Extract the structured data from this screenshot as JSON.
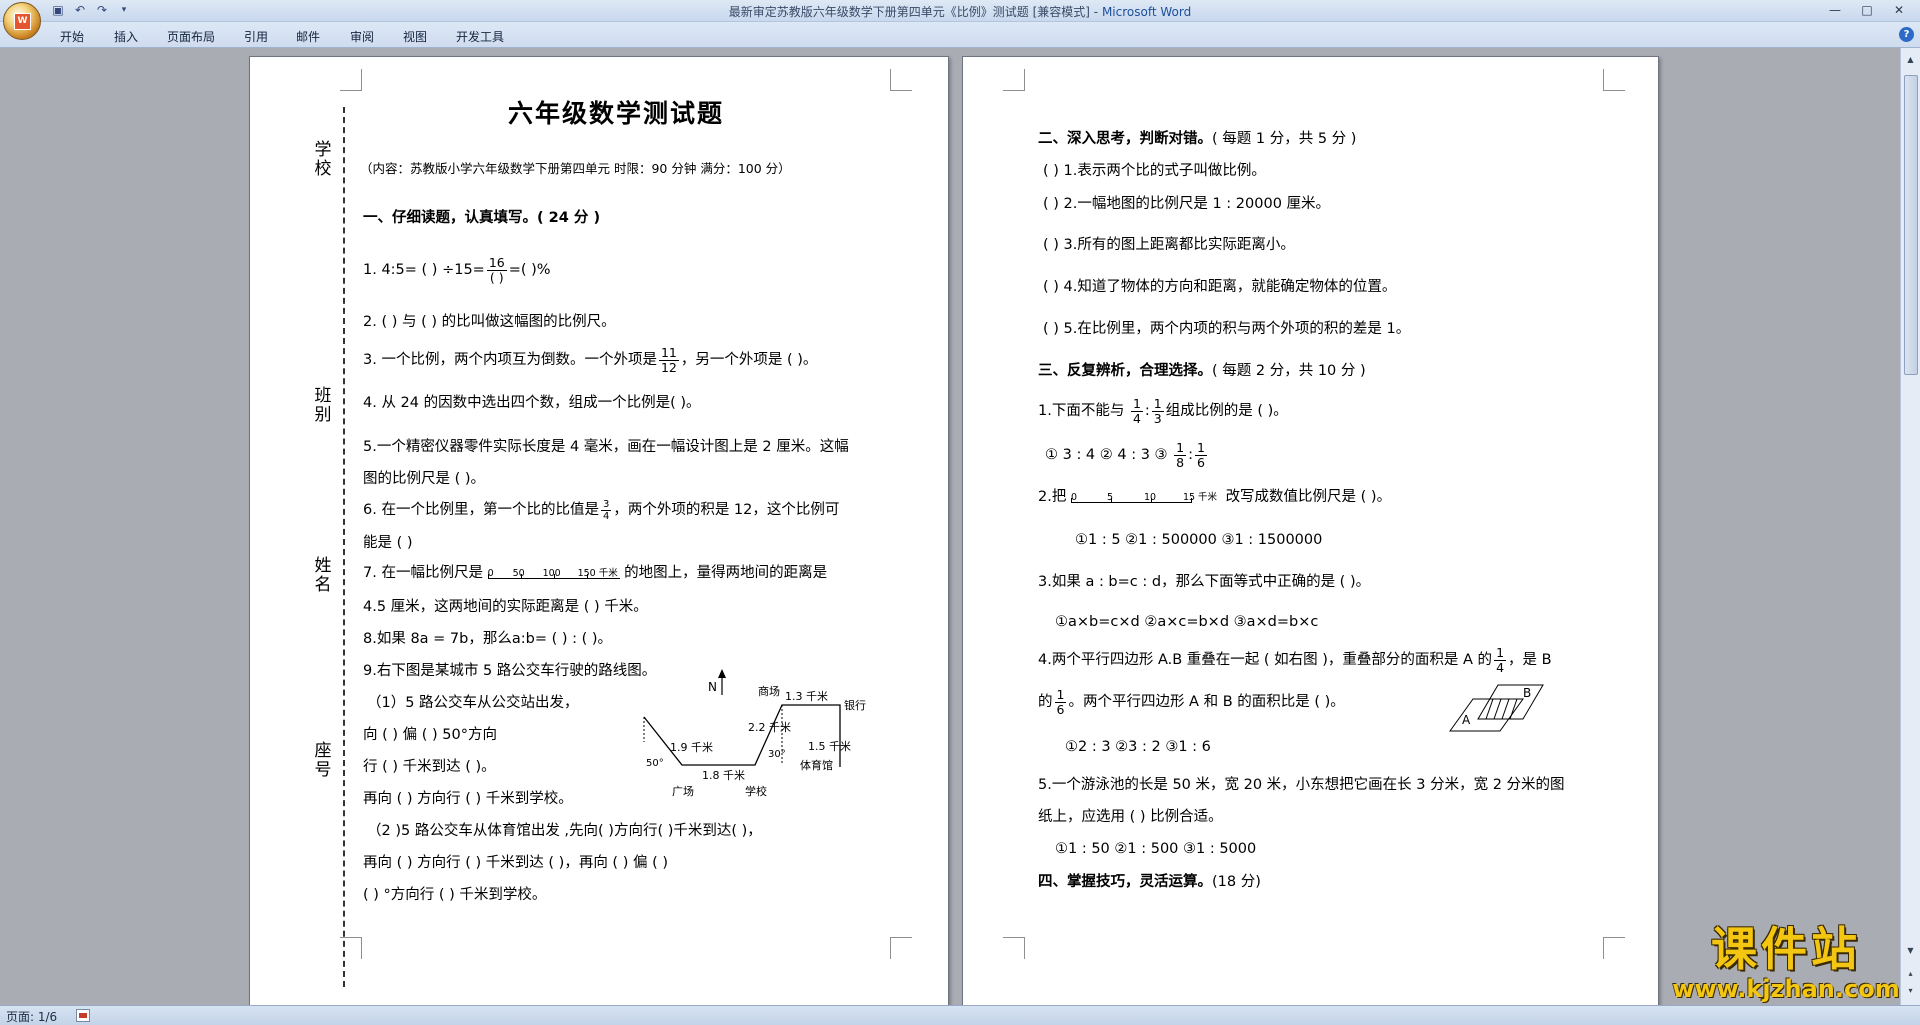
{
  "window": {
    "title": "最新审定苏教版六年级数学下册第四单元《比例》测试题 [兼容模式] -",
    "app": "Microsoft Word"
  },
  "quick_access": [
    "save-icon",
    "undo-icon",
    "redo-icon",
    "customize-icon"
  ],
  "ribbon_tabs": [
    "开始",
    "插入",
    "页面布局",
    "引用",
    "邮件",
    "审阅",
    "视图",
    "开发工具"
  ],
  "status": {
    "page": "页面: 1/6"
  },
  "watermark": {
    "text": "课件站",
    "url": "www.kjzhan.com"
  },
  "side_labels": [
    "学校",
    "班别",
    "姓名",
    "座号"
  ],
  "page1": {
    "title": "六年级数学测试题",
    "subtitle": "（内容：苏教版小学六年级数学下册第四单元    时限：90 分钟    满分：100 分）",
    "s1": "一、仔细读题，认真填写。( 24 分 )",
    "q1a": "1.   4:5= (         ) ÷15=",
    "q1n": "16",
    "q1d": "(       )",
    "q1b": "=(         )%",
    "q2": "2. (                                ) 与 (                              ) 的比叫做这幅图的比例尺。",
    "q3a": "3.  一个比例，两个内项互为倒数。一个外项是",
    "q3n": "11",
    "q3d": "12",
    "q3b": "，另一个外项是 (          )。",
    "q4": "4.  从 24 的因数中选出四个数，组成一个比例是(                                              )。",
    "q5a": "5.一个精密仪器零件实际长度是 4 毫米，画在一幅设计图上是 2 厘米。这幅",
    "q5b": "图的比例尺是 (            )。",
    "q6a": "6.  在一个比例里，第一个比的比值是",
    "q6n": "3",
    "q6d": "4",
    "q6b": "，两个外项的积是 12，这个比例可",
    "q6c": "能是 (                     )",
    "q7a": "7.  在一幅比例尺是",
    "q7ticks": [
      "0",
      "50",
      "100",
      "150 千米"
    ],
    "q7b": "的地图上，量得两地间的距离是",
    "q7c": "4.5 厘米，这两地间的实际距离是 (              ) 千米。",
    "q8": "8.如果 8a = 7b，那么a:b= (          ) : (          )。",
    "q9": "9.右下图是某城市 5 路公交车行驶的路线图。",
    "q9_1a": "（1）5 路公交车从公交站出发，",
    "q9_1b": "向 (          ) 偏 (          ) 50°方向",
    "q9_1c": "行 (            ) 千米到达 (             )。",
    "q9_1d": "再向 (            ) 方向行 (           ) 千米到学校。",
    "q9_2a": "（2 )5 路公交车从体育馆出发 ,先向(              )方向行(            )千米到达(            )，",
    "q9_2b": "再向 (            ) 方向行 (          ) 千米到达 (               )，再向 (            ) 偏 (          )",
    "q9_2c": "(            ) °方向行 (              ) 千米到学校。",
    "map": {
      "north": "N",
      "shop": "商场",
      "d13": "1.3 千米",
      "bank": "银行",
      "d22": "2.2 千米",
      "d19": "1.9 千米",
      "a30": "30°",
      "d15": "1.5 千米",
      "a50": "50°",
      "gym": "体育馆",
      "d18": "1.8 千米",
      "square": "广场",
      "school": "学校"
    }
  },
  "page2": {
    "s2": "二、深入思考，判断对错。",
    "s2b": "( 每题 1 分，共 5 分 )",
    "j1": "(           ) 1.表示两个比的式子叫做比例。",
    "j2": "(           ) 2.一幅地图的比例尺是 1 : 20000 厘米。",
    "j3": "(           ) 3.所有的图上距离都比实际距离小。",
    "j4": "(           ) 4.知道了物体的方向和距离，就能确定物体的位置。",
    "j5": "(           ) 5.在比例里，两个内项的积与两个外项的积的差是 1。",
    "s3": "三、反复辨析，合理选择。",
    "s3b": "( 每题 2 分，共 10 分 )",
    "c1a": "1.下面不能与",
    "c1b": "组成比例的是 (           )。",
    "c1_opts_a": "①  3 : 4      ②  4 : 3      ③",
    "c2a": "2.把",
    "c2ticks": [
      "0",
      "5",
      "10",
      "15 千米"
    ],
    "c2b": "改写成数值比例尺是 (          )。",
    "c2_opts": "①1 : 5       ②1 : 500000        ③1 : 1500000",
    "c3": "3.如果 a : b=c : d，那么下面等式中正确的是 (           )。",
    "c3_opts": "①a×b=c×d         ②a×c=b×d         ③a×d=b×c",
    "c4a": "4.两个平行四边形 A.B 重叠在一起 ( 如右图 )，重叠部分的面积是 A 的",
    "c4b": "，是 B",
    "c4c": "的",
    "c4d": "。两个平行四边形 A 和 B 的面积比是 (              )。",
    "c4_opts": "①2 : 3              ②3 : 2              ③1 : 6",
    "c4_fig": {
      "a": "A",
      "b": "B"
    },
    "c5a": "5.一个游泳池的长是 50 米，宽 20 米，小东想把它画在长 3 分米，宽 2 分米的图",
    "c5b": "纸上，应选用 (          ) 比例合适。",
    "c5_opts": "①1 : 50            ②1 : 500            ③1 : 5000",
    "s4": "四、掌握技巧，灵活运算。",
    "s4b": "(18 分)",
    "frac_1": "1",
    "frac_4": "4",
    "frac_3": "3",
    "frac_8": "8",
    "frac_6": "6",
    "colon": ":"
  }
}
